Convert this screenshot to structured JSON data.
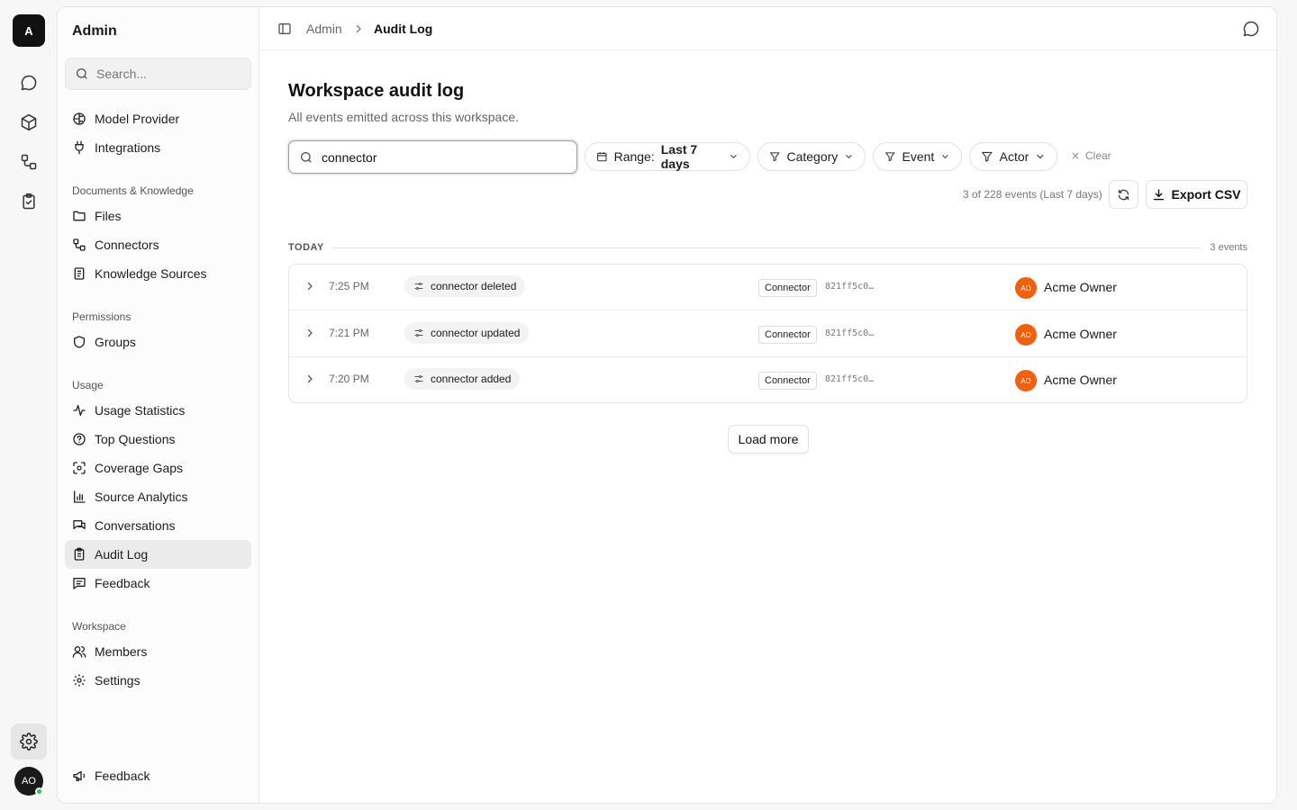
{
  "rail": {
    "logo": "A",
    "avatar": "AO",
    "icons": [
      "chat-icon",
      "box-icon",
      "connectors-icon",
      "clipboard-check-icon",
      "settings-icon"
    ]
  },
  "sidebar": {
    "title": "Admin",
    "search_placeholder": "Search...",
    "top_items": [
      {
        "label": "Model Provider",
        "icon": "brain-icon"
      },
      {
        "label": "Integrations",
        "icon": "plug-icon"
      }
    ],
    "groups": [
      {
        "label": "Documents & Knowledge",
        "items": [
          "Files",
          "Connectors",
          "Knowledge Sources"
        ]
      },
      {
        "label": "Permissions",
        "items": [
          "Groups"
        ]
      },
      {
        "label": "Usage",
        "items": [
          "Usage Statistics",
          "Top Questions",
          "Coverage Gaps",
          "Source Analytics",
          "Conversations",
          "Audit Log",
          "Feedback"
        ]
      },
      {
        "label": "Workspace",
        "items": [
          "Members",
          "Settings"
        ]
      }
    ],
    "bottom_item": "Feedback",
    "active": "Audit Log"
  },
  "breadcrumb": {
    "root": "Admin",
    "current": "Audit Log"
  },
  "page": {
    "title": "Workspace audit log",
    "subtitle": "All events emitted across this workspace."
  },
  "filters": {
    "search_value": "connector",
    "range_label": "Range:",
    "range_value": "Last 7 days",
    "category": "Category",
    "event": "Event",
    "actor": "Actor",
    "clear": "Clear",
    "count_text": "3 of 228 events (Last 7 days)",
    "export": "Export CSV"
  },
  "day": {
    "label": "TODAY",
    "count": "3 events"
  },
  "events": [
    {
      "time": "7:25 PM",
      "event": "connector deleted",
      "tag": "Connector",
      "hash": "821ff5c0…",
      "actor_initials": "AO",
      "actor": "Acme Owner"
    },
    {
      "time": "7:21 PM",
      "event": "connector updated",
      "tag": "Connector",
      "hash": "821ff5c0…",
      "actor_initials": "AO",
      "actor": "Acme Owner"
    },
    {
      "time": "7:20 PM",
      "event": "connector added",
      "tag": "Connector",
      "hash": "821ff5c0…",
      "actor_initials": "AO",
      "actor": "Acme Owner"
    }
  ],
  "load_more": "Load more",
  "colors": {
    "accent_avatar": "#f2600c",
    "online": "#22c55e"
  }
}
